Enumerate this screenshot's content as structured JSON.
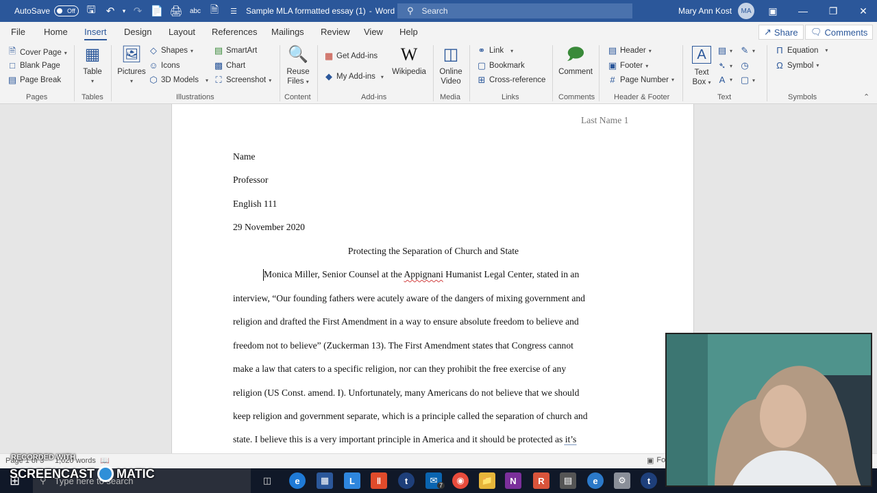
{
  "titlebar": {
    "autosave_label": "AutoSave",
    "autosave_state": "Off",
    "doc_title": "Sample MLA formatted essay (1)",
    "separator": "-",
    "app_name": "Word",
    "search_placeholder": "Search",
    "user_name": "Mary Ann Kost",
    "user_initials": "MA"
  },
  "tabs": [
    "File",
    "Home",
    "Insert",
    "Design",
    "Layout",
    "References",
    "Mailings",
    "Review",
    "View",
    "Help"
  ],
  "active_tab": "Insert",
  "share_label": "Share",
  "comments_label": "Comments",
  "ribbon": {
    "pages": {
      "cover_page": "Cover Page",
      "blank_page": "Blank Page",
      "page_break": "Page Break",
      "group": "Pages"
    },
    "tables": {
      "table": "Table",
      "group": "Tables"
    },
    "illustrations": {
      "pictures": "Pictures",
      "shapes": "Shapes",
      "icons": "Icons",
      "models_3d": "3D Models",
      "smartart": "SmartArt",
      "chart": "Chart",
      "screenshot": "Screenshot",
      "group": "Illustrations"
    },
    "content": {
      "reuse_files_1": "Reuse",
      "reuse_files_2": "Files",
      "group": "Content"
    },
    "addins": {
      "get_addins": "Get Add-ins",
      "my_addins": "My Add-ins",
      "wikipedia": "Wikipedia",
      "group": "Add-ins"
    },
    "media": {
      "online_video_1": "Online",
      "online_video_2": "Video",
      "group": "Media"
    },
    "links": {
      "link": "Link",
      "bookmark": "Bookmark",
      "cross_reference": "Cross-reference",
      "group": "Links"
    },
    "comments": {
      "comment": "Comment",
      "group": "Comments"
    },
    "header_footer": {
      "header": "Header",
      "footer": "Footer",
      "page_number": "Page Number",
      "group": "Header & Footer"
    },
    "text": {
      "text_box_1": "Text",
      "text_box_2": "Box",
      "group": "Text"
    },
    "symbols": {
      "equation": "Equation",
      "symbol": "Symbol",
      "group": "Symbols"
    }
  },
  "document": {
    "running_header": "Last Name 1",
    "heading_lines": [
      "Name",
      "Professor",
      "English 111",
      "29 November 2020"
    ],
    "title": "Protecting the Separation of Church and State",
    "body": {
      "l1_pre": "Monica Miller, Senior Counsel at the ",
      "l1_sq": "Appignani",
      "l1_post": " Humanist Legal Center, stated in an",
      "l2": "interview, “Our founding fathers were acutely aware of the dangers of mixing government and",
      "l3": "religion and drafted the First Amendment in a way to ensure absolute freedom to believe and",
      "l4": "freedom not to believe” (Zuckerman 13). The First Amendment states that Congress cannot",
      "l5": "make a law that caters to a specific religion, nor can they prohibit the free exercise of any",
      "l6": "religion (US Const. amend. I). Unfortunately, many Americans do not believe that we should",
      "l7": "keep religion and government separate, which is a principle called the separation of church and",
      "l8_pre": "state. I believe this is a very important principle in America and it should be protected as ",
      "l8_u": "it’s"
    }
  },
  "statusbar": {
    "page_info": "Page 1 of 3",
    "words": "1,020 words",
    "focus": "Focus"
  },
  "taskbar": {
    "search_placeholder": "Type here to search",
    "badge_count": "7"
  },
  "watermark": {
    "recorded_with": "RECORDED WITH",
    "brand_left": "SCREENCAST",
    "brand_right": "MATIC"
  }
}
